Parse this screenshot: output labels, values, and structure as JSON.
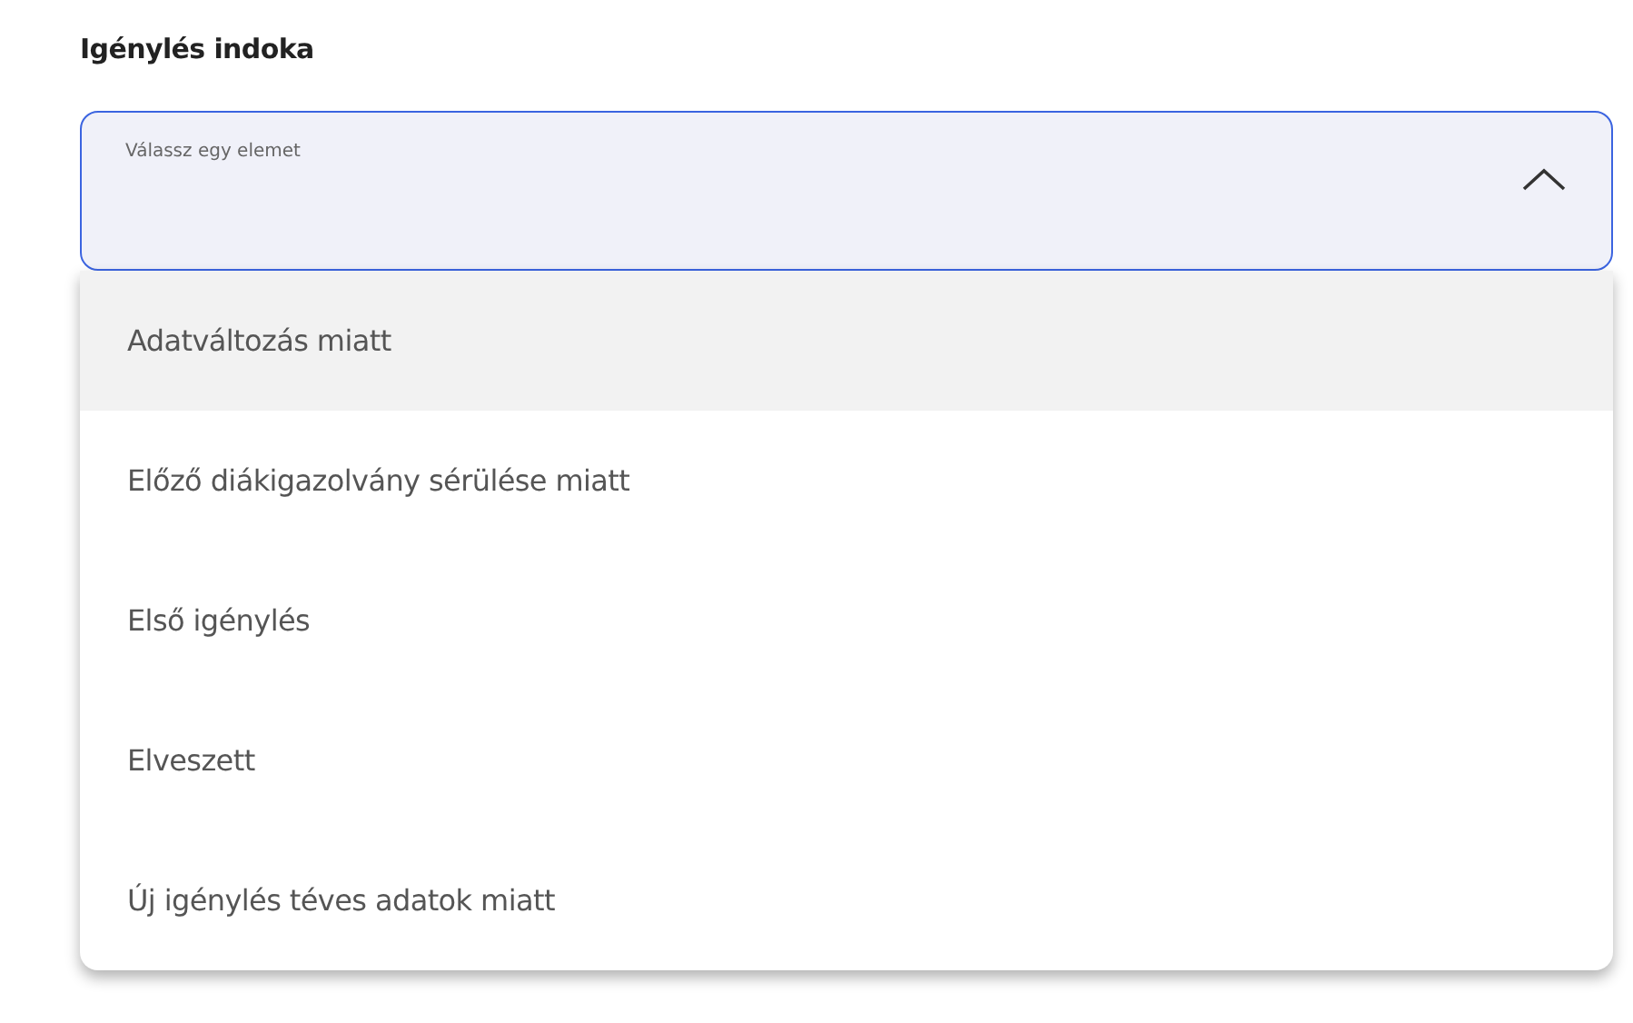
{
  "field_label": "Igénylés indoka",
  "select": {
    "placeholder": "Válassz egy elemet",
    "expanded": true
  },
  "options": [
    {
      "label": "Adatváltozás miatt",
      "hovered": true,
      "selected": false
    },
    {
      "label": "Előző diákigazolvány sérülése miatt",
      "hovered": false,
      "selected": false
    },
    {
      "label": "Első igénylés",
      "hovered": false,
      "selected": false
    },
    {
      "label": "Elveszett",
      "hovered": false,
      "selected": false
    },
    {
      "label": "Új igénylés téves adatok miatt",
      "hovered": false,
      "selected": false
    }
  ]
}
